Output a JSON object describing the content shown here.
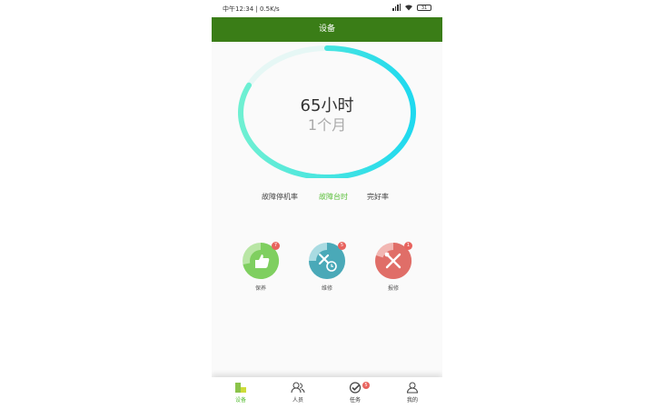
{
  "status_bar": {
    "left_text": "中午12:34 | 0.5K/s",
    "battery": "31"
  },
  "header": {
    "title": "设备"
  },
  "ring": {
    "main_value": "65小时",
    "sub_value": "1个月",
    "progress": 0.82,
    "color_start": "#6ff0d2",
    "color_end": "#1fd9ef"
  },
  "tabs": [
    {
      "label": "故障停机率",
      "active": false
    },
    {
      "label": "故障台时",
      "active": true
    },
    {
      "label": "完好率",
      "active": false
    }
  ],
  "categories": [
    {
      "label": "保养",
      "badge": "7",
      "icon": "thumbs-up-icon",
      "color": "#7fcf60"
    },
    {
      "label": "维修",
      "badge": "5",
      "icon": "tools-clock-icon",
      "color": "#4aa9b8"
    },
    {
      "label": "报修",
      "badge": "1",
      "icon": "wrench-screwdriver-icon",
      "color": "#e06e68"
    }
  ],
  "bottom_nav": [
    {
      "label": "设备",
      "icon": "device-icon",
      "active": true,
      "badge": ""
    },
    {
      "label": "人员",
      "icon": "people-icon",
      "active": false,
      "badge": ""
    },
    {
      "label": "任务",
      "icon": "task-check-icon",
      "active": false,
      "badge": "5"
    },
    {
      "label": "我的",
      "icon": "profile-icon",
      "active": false,
      "badge": ""
    }
  ],
  "colors": {
    "header": "#3a7d17",
    "active": "#5bbf3a",
    "badge": "#e8635e"
  }
}
